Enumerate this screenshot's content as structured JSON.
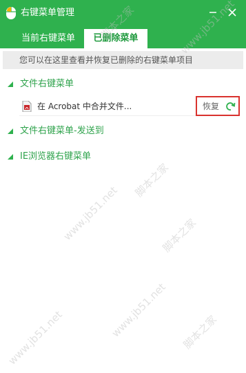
{
  "window": {
    "title": "右键菜单管理",
    "app_icon": "mouse-icon",
    "minimize_icon": "minimize-icon",
    "close_icon": "close-icon"
  },
  "tabs": [
    {
      "label": "当前右键菜单",
      "active": false
    },
    {
      "label": "已删除菜单",
      "active": true
    }
  ],
  "hint": "您可以在这里查看并恢复已删除的右键菜单项目",
  "sections": [
    {
      "label": "文件右键菜单",
      "expanded": true,
      "items": [
        {
          "label": "在 Acrobat 中合并文件...",
          "icon": "acrobat-file-icon",
          "action_label": "恢复",
          "action_icon": "restore-arrow-icon"
        }
      ]
    },
    {
      "label": "文件右键菜单-发送到",
      "expanded": true,
      "items": []
    },
    {
      "label": "IE浏览器右键菜单",
      "expanded": true,
      "items": []
    }
  ],
  "watermark": {
    "cn": "脚本之家",
    "url": "www.jb51.net"
  },
  "colors": {
    "brand_green": "#2fb14e",
    "section_text": "#2fa34c",
    "highlight_border": "#d9322e",
    "hint_background": "#ececec"
  }
}
